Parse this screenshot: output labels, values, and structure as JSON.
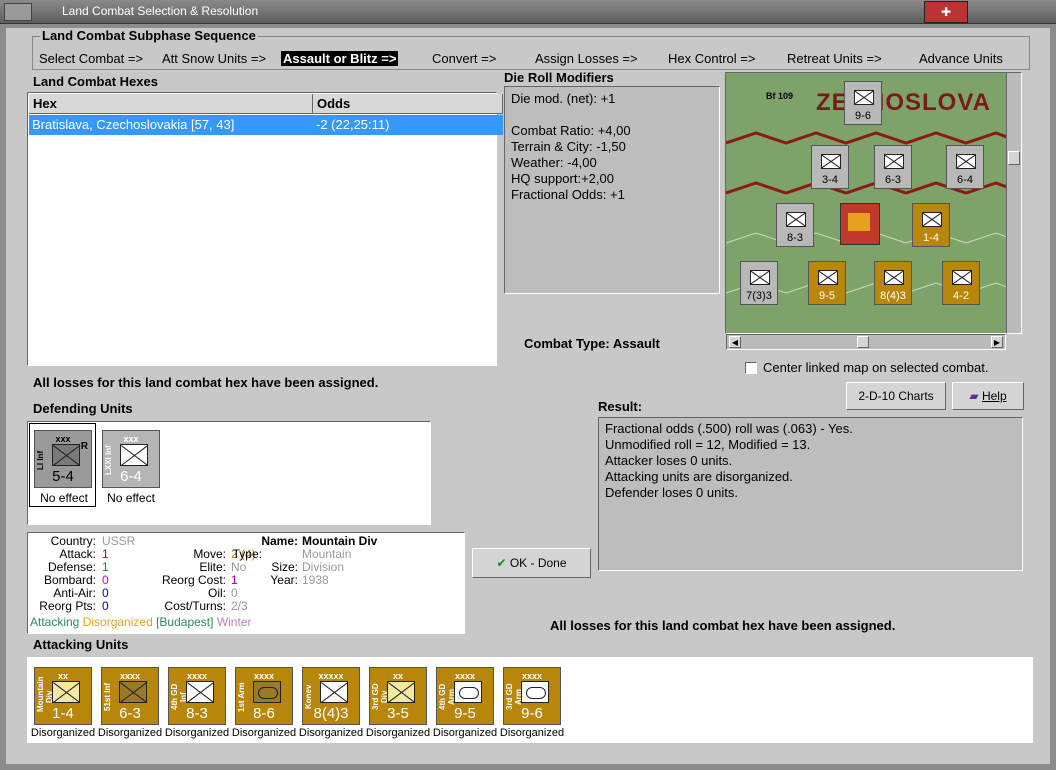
{
  "window": {
    "title": "Land Combat Selection & Resolution"
  },
  "subphase": {
    "title": "Land Combat Subphase Sequence",
    "steps": [
      {
        "label": "Select Combat =>",
        "active": false
      },
      {
        "label": "Att Snow Units =>",
        "active": false
      },
      {
        "label": "Assault or Blitz =>",
        "active": true
      },
      {
        "label": "Convert =>",
        "active": false
      },
      {
        "label": "Assign Losses =>",
        "active": false
      },
      {
        "label": "Hex Control =>",
        "active": false
      },
      {
        "label": "Retreat Units =>",
        "active": false
      },
      {
        "label": "Advance Units",
        "active": false
      }
    ]
  },
  "hexes": {
    "title": "Land Combat Hexes",
    "columns": [
      "Hex",
      "Odds"
    ],
    "rows": [
      {
        "hex": "Bratislava, Czechoslovakia [57, 43]",
        "odds": "-2 (22,25:11)"
      }
    ]
  },
  "die_roll": {
    "title": "Die Roll Modifiers",
    "lines": [
      "Die mod. (net): +1",
      "",
      "Combat Ratio: +4,00",
      "Terrain & City: -1,50",
      "Weather: -4,00",
      "HQ support:+2,00",
      "Fractional Odds: +1"
    ]
  },
  "map": {
    "label": "ZECHOSLOVA",
    "counters": [
      {
        "top": "9-6",
        "color": "grey"
      },
      {
        "top": "3-4",
        "color": "grey"
      },
      {
        "top": "6-3",
        "color": "grey"
      },
      {
        "top": "6-4",
        "color": "grey"
      },
      {
        "top": "8-3",
        "color": "grey"
      },
      {
        "top": "1-4",
        "color": "gold"
      },
      {
        "top": "7(3)3",
        "color": "grey"
      },
      {
        "top": "9-5",
        "color": "gold"
      },
      {
        "top": "8(4)3",
        "color": "gold"
      },
      {
        "top": "4-2",
        "color": "gold"
      }
    ],
    "bf109_label": "Bf 109"
  },
  "combat_type": {
    "label": "Combat Type:",
    "value": "Assault"
  },
  "center_linked": {
    "label": "Center linked map on selected combat."
  },
  "losses_message": "All losses for this land combat hex have been assigned.",
  "defending": {
    "title": "Defending Units",
    "units": [
      {
        "size": "xxx",
        "name": "LI Inf",
        "mark": "R",
        "strength": "5-4",
        "effect": "No effect",
        "style": "dark"
      },
      {
        "size": "xxx",
        "name": "LXXI Inf",
        "mark": "",
        "strength": "6-4",
        "effect": "No effect",
        "style": "light"
      }
    ]
  },
  "info": {
    "country_label": "Country:",
    "country": "USSR",
    "attack_label": "Attack:",
    "attack": "1",
    "defense_label": "Defense:",
    "defense": "1",
    "bombard_label": "Bombard:",
    "bombard": "0",
    "antiair_label": "Anti-Air:",
    "antiair": "0",
    "reorg_label": "Reorg Pts:",
    "reorg": "0",
    "move_label": "Move:",
    "move": "2 (4)",
    "elite_label": "Elite:",
    "elite": "No",
    "reorgcost_label": "Reorg Cost:",
    "reorgcost": "1",
    "oil_label": "Oil:",
    "oil": "0",
    "costturns_label": "Cost/Turns:",
    "costturns": "2/3",
    "name_label": "Name:",
    "name": "Mountain Div",
    "type_label": "Type:",
    "type": "Mountain",
    "size_label": "Size:",
    "size": "Division",
    "year_label": "Year:",
    "year": "1938",
    "tags": [
      "Attacking",
      "Disorganized",
      "[Budapest]",
      "Winter"
    ]
  },
  "result": {
    "title": "Result:",
    "lines": [
      "Fractional odds (.500) roll was (.063)  - Yes.",
      "Unmodified roll = 12, Modified = 13.",
      "Attacker loses 0 units.",
      "Attacking units are disorganized.",
      "Defender loses 0 units."
    ]
  },
  "buttons": {
    "charts": "2-D-10 Charts",
    "help": "Help",
    "ok": "OK - Done"
  },
  "attacking": {
    "title": "Attacking Units",
    "units": [
      {
        "size": "xx",
        "name": "Mountain Div",
        "strength": "1-4",
        "status": "Disorganized",
        "glyph": "x",
        "light": true
      },
      {
        "size": "xxxx",
        "name": "51st Inf",
        "strength": "6-3",
        "status": "Disorganized",
        "glyph": "x",
        "light": false
      },
      {
        "size": "xxxx",
        "name": "4th GD Inf",
        "strength": "8-3",
        "status": "Disorganized",
        "glyph": "x",
        "light": false
      },
      {
        "size": "xxxx",
        "name": "1st Arm",
        "strength": "8-6",
        "status": "Disorganized",
        "glyph": "oval",
        "light": false
      },
      {
        "size": "xxxxx",
        "name": "Konev",
        "strength": "8(4)3",
        "status": "Disorganized",
        "glyph": "x",
        "light": false
      },
      {
        "size": "xx",
        "name": "3rd GD Div",
        "strength": "3-5",
        "status": "Disorganized",
        "glyph": "x",
        "light": true
      },
      {
        "size": "xxxx",
        "name": "4th GD Arm",
        "strength": "9-5",
        "status": "Disorganized",
        "glyph": "oval",
        "light": false
      },
      {
        "size": "xxxx",
        "name": "3rd GD Arm",
        "strength": "9-6",
        "status": "Disorganized",
        "glyph": "oval",
        "light": false
      }
    ]
  },
  "colors": {
    "highlight": "#3399ff",
    "soviet_gold": "#b8860b",
    "attacking_tag": "#2e8b57",
    "disorganized_tag": "#daa520",
    "winter_tag": "#c080c0"
  }
}
